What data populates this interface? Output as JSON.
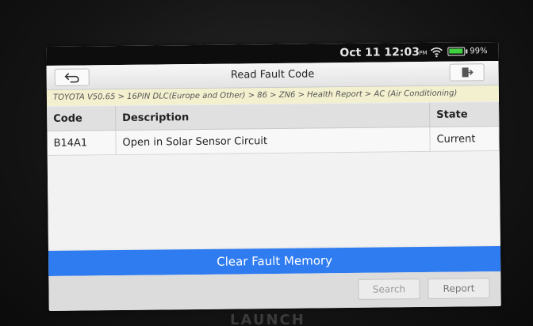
{
  "status_bar": {
    "date": "Oct 11",
    "time": "12:03",
    "ampm": "PM",
    "battery_percent": "99%",
    "battery_level": 0.99,
    "wifi_icon": "wifi-icon",
    "battery_icon": "battery-icon"
  },
  "header": {
    "title": "Read Fault Code",
    "back_icon": "back-arrow-icon",
    "exit_icon": "exit-icon"
  },
  "breadcrumb": "TOYOTA V50.65 > 16PIN DLC(Europe and Other) > 86 > ZN6 > Health Report > AC (Air Conditioning)",
  "table": {
    "columns": [
      "Code",
      "Description",
      "State"
    ],
    "rows": [
      {
        "code": "B14A1",
        "description": "Open in Solar Sensor Circuit",
        "state": "Current"
      }
    ]
  },
  "actions": {
    "clear": "Clear Fault Memory",
    "search": "Search",
    "report": "Report"
  },
  "colors": {
    "accent": "#2f7cf0",
    "breadcrumb_bg": "#f3f0cf",
    "battery": "#3fd13f"
  },
  "bezel_brand": "LAUNCH"
}
